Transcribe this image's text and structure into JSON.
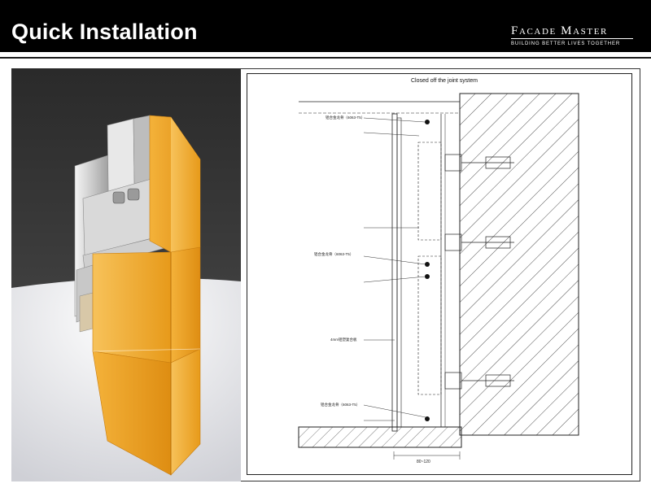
{
  "header": {
    "title": "Quick Installation",
    "brand": "Facade Master",
    "tagline": "BUILDING BETTER LIVES TOGETHER"
  },
  "drawing": {
    "title": "Closed off the joint system",
    "labels": {
      "profile_top": "铝合金龙骨（6063-T5）",
      "profile_mid": "铝合金龙骨（6063-T5）",
      "profile_bottom": "铝合金龙骨（6063-T5）",
      "panel": "4mm铝塑复合板",
      "dimension": "80~120"
    }
  },
  "colors": {
    "header_bg": "#000000",
    "panel_orange": "#f2a92a",
    "render_bg": "#2b2b2b",
    "floor": "#e6e6ea"
  }
}
